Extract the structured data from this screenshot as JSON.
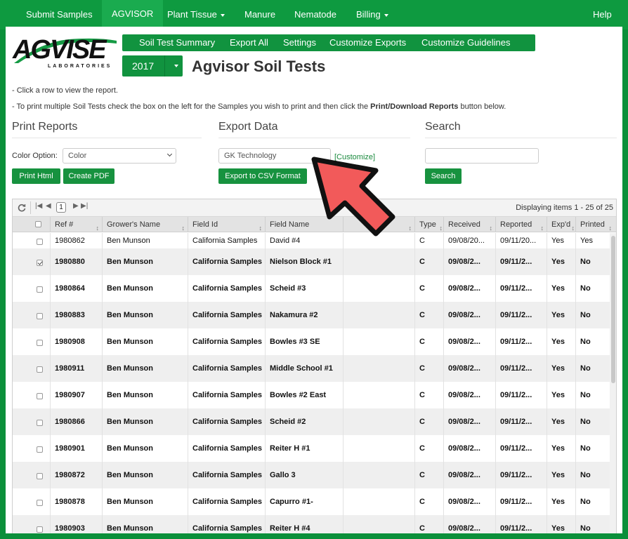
{
  "topnav": {
    "items": [
      {
        "label": "Submit Samples"
      },
      {
        "label": "AGVISOR"
      },
      {
        "label": "Plant Tissue"
      },
      {
        "label": "Manure"
      },
      {
        "label": "Nematode"
      },
      {
        "label": "Billing"
      },
      {
        "label": "Help"
      }
    ]
  },
  "logo": {
    "text": "AGVISE",
    "subtext": "LABORATORIES"
  },
  "subnav": {
    "items": [
      {
        "label": "Soil Test Summary"
      },
      {
        "label": "Export All"
      },
      {
        "label": "Settings"
      },
      {
        "label": "Customize Exports"
      },
      {
        "label": "Customize Guidelines"
      }
    ]
  },
  "year": "2017",
  "page_title": "Agvisor Soil Tests",
  "instructions": {
    "line1": "- Click a row to view the report.",
    "line2_pre": "- To print multiple Soil Tests check the box on the left for the Samples you wish to print and then click the ",
    "line2_bold": "Print/Download Reports",
    "line2_post": " button below."
  },
  "print": {
    "title": "Print Reports",
    "color_label": "Color Option:",
    "color_value": "Color",
    "print_html": "Print Html",
    "create_pdf": "Create PDF"
  },
  "export": {
    "title": "Export Data",
    "format_value": "GK Technology",
    "customize_link": "[Customize]",
    "export_btn": "Export to CSV Format"
  },
  "search": {
    "title": "Search",
    "value": "",
    "button": "Search"
  },
  "grid": {
    "page": "1",
    "display": "Displaying items 1 - 25 of 25",
    "columns": [
      "Ref #",
      "Grower's Name",
      "Field Id",
      "Field Name",
      "",
      "Type",
      "Received",
      "Reported",
      "Exp'd",
      "Printed"
    ],
    "rows": [
      {
        "checked": false,
        "ref": "1980862",
        "grower": "Ben Munson",
        "field_id": "California Samples",
        "field_name": "David #4",
        "type": "C",
        "received": "09/08/20...",
        "reported": "09/11/20...",
        "exported": "Yes",
        "printed": "Yes"
      },
      {
        "checked": true,
        "ref": "1980880",
        "grower": "Ben Munson",
        "field_id": "California Samples",
        "field_name": "Nielson Block #1",
        "type": "C",
        "received": "09/08/2...",
        "reported": "09/11/2...",
        "exported": "Yes",
        "printed": "No"
      },
      {
        "checked": false,
        "ref": "1980864",
        "grower": "Ben Munson",
        "field_id": "California Samples",
        "field_name": "Scheid #3",
        "type": "C",
        "received": "09/08/2...",
        "reported": "09/11/2...",
        "exported": "Yes",
        "printed": "No"
      },
      {
        "checked": false,
        "ref": "1980883",
        "grower": "Ben Munson",
        "field_id": "California Samples",
        "field_name": "Nakamura #2",
        "type": "C",
        "received": "09/08/2...",
        "reported": "09/11/2...",
        "exported": "Yes",
        "printed": "No"
      },
      {
        "checked": false,
        "ref": "1980908",
        "grower": "Ben Munson",
        "field_id": "California Samples",
        "field_name": "Bowles #3 SE",
        "type": "C",
        "received": "09/08/2...",
        "reported": "09/11/2...",
        "exported": "Yes",
        "printed": "No"
      },
      {
        "checked": false,
        "ref": "1980911",
        "grower": "Ben Munson",
        "field_id": "California Samples",
        "field_name": "Middle School #1",
        "type": "C",
        "received": "09/08/2...",
        "reported": "09/11/2...",
        "exported": "Yes",
        "printed": "No"
      },
      {
        "checked": false,
        "ref": "1980907",
        "grower": "Ben Munson",
        "field_id": "California Samples",
        "field_name": "Bowles #2 East",
        "type": "C",
        "received": "09/08/2...",
        "reported": "09/11/2...",
        "exported": "Yes",
        "printed": "No"
      },
      {
        "checked": false,
        "ref": "1980866",
        "grower": "Ben Munson",
        "field_id": "California Samples",
        "field_name": "Scheid #2",
        "type": "C",
        "received": "09/08/2...",
        "reported": "09/11/2...",
        "exported": "Yes",
        "printed": "No"
      },
      {
        "checked": false,
        "ref": "1980901",
        "grower": "Ben Munson",
        "field_id": "California Samples",
        "field_name": "Reiter H #1",
        "type": "C",
        "received": "09/08/2...",
        "reported": "09/11/2...",
        "exported": "Yes",
        "printed": "No"
      },
      {
        "checked": false,
        "ref": "1980872",
        "grower": "Ben Munson",
        "field_id": "California Samples",
        "field_name": "Gallo 3",
        "type": "C",
        "received": "09/08/2...",
        "reported": "09/11/2...",
        "exported": "Yes",
        "printed": "No"
      },
      {
        "checked": false,
        "ref": "1980878",
        "grower": "Ben Munson",
        "field_id": "California Samples",
        "field_name": "Capurro #1-",
        "type": "C",
        "received": "09/08/2...",
        "reported": "09/11/2...",
        "exported": "Yes",
        "printed": "No"
      },
      {
        "checked": false,
        "ref": "1980903",
        "grower": "Ben Munson",
        "field_id": "California Samples",
        "field_name": "Reiter H #4",
        "type": "C",
        "received": "09/08/2...",
        "reported": "09/11/2...",
        "exported": "Yes",
        "printed": "No"
      }
    ]
  },
  "colors": {
    "brand_green": "#0e9a40",
    "active_underline": "#e6ff3a",
    "annotation_arrow": "#f25a5a"
  }
}
